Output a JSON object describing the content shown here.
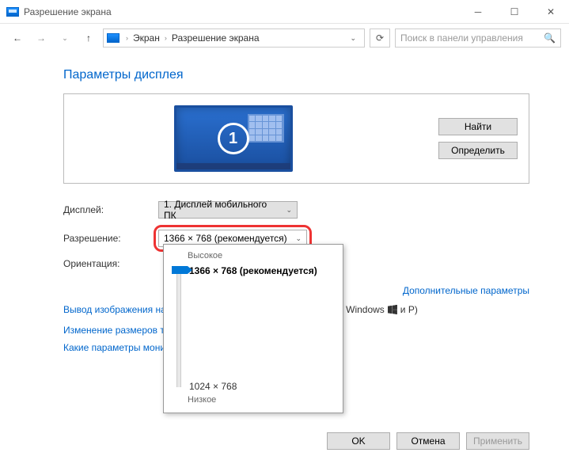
{
  "titlebar": {
    "title": "Разрешение экрана"
  },
  "nav": {
    "crumb1": "Экран",
    "crumb2": "Разрешение экрана",
    "search_placeholder": "Поиск в панели управления"
  },
  "page": {
    "title": "Параметры дисплея",
    "monitor_number": "1",
    "find_btn": "Найти",
    "detect_btn": "Определить"
  },
  "form": {
    "display_label": "Дисплей:",
    "display_value": "1. Дисплей мобильного ПК",
    "resolution_label": "Разрешение:",
    "resolution_value": "1366 × 768 (рекомендуется)",
    "orientation_label": "Ориентация:"
  },
  "popup": {
    "high": "Высокое",
    "current": "1366 × 768 (рекомендуется)",
    "min": "1024 × 768",
    "low": "Низкое"
  },
  "links": {
    "advanced": "Дополнительные параметры",
    "hint_prefix": "Вывод изображения на",
    "hint_suffix_a": "отипом Windows",
    "hint_suffix_b": "и P)",
    "resize_text": "Изменение размеров те",
    "which_params": "Какие параметры мони"
  },
  "footer": {
    "ok": "OK",
    "cancel": "Отмена",
    "apply": "Применить"
  }
}
